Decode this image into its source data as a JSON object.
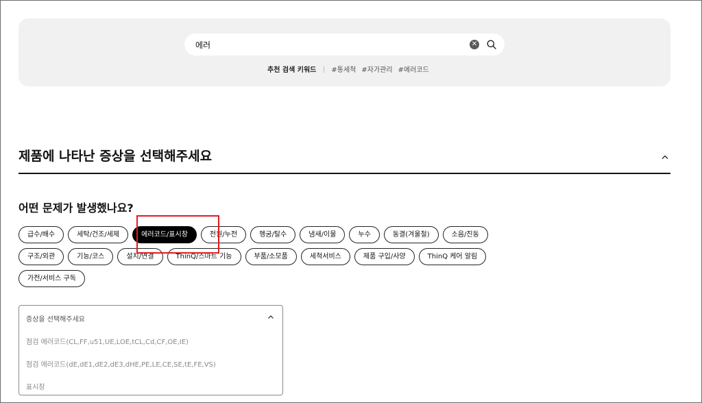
{
  "search": {
    "value": "에러",
    "keywords_label": "추천 검색 키워드",
    "keywords": [
      "#통세척",
      "#자가관리",
      "#에러코드"
    ]
  },
  "symptom_section": {
    "title": "제품에 나타난 증상을 선택해주세요",
    "question": "어떤 문제가 발생했나요?"
  },
  "categories": {
    "row1": [
      "급수/배수",
      "세탁/건조/세제",
      "에러코드/표시창",
      "전원/누전",
      "헹굼/탈수",
      "냄새/이물",
      "누수",
      "동결(겨울철)",
      "소음/진동"
    ],
    "row2": [
      "구조/외관",
      "기능/코스",
      "설치/연결",
      "ThinQ/스마트 기능",
      "부품/소모품",
      "세척서비스",
      "제품 구입/사양",
      "ThinQ 케어 알림"
    ],
    "row3": [
      "가전/서비스 구독"
    ],
    "selected": "에러코드/표시창"
  },
  "dropdown": {
    "placeholder": "증상을 선택해주세요",
    "options": [
      "점검 에러코드(CL,FF,u51,UE,LOE,tCL,Cd,CF,OE,IE)",
      "점검 에러코드(dE,dE1,dE2,dE3,dHE,PE,LE,CE,SE,tE,FE,VS)",
      "표시창"
    ]
  },
  "colors": {
    "panel_bg": "#f1f1f1",
    "chip_selected_bg": "#000000",
    "highlight_border": "#e0191e"
  },
  "icons": {
    "clear": "close-circle-icon",
    "search": "search-icon",
    "collapse": "chevron-up-icon",
    "dropdown": "chevron-up-icon"
  }
}
